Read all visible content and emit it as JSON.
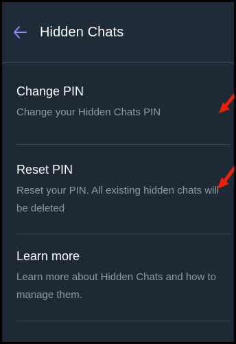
{
  "header": {
    "title": "Hidden Chats",
    "back_icon": "arrow-left-icon"
  },
  "items": [
    {
      "title": "Change PIN",
      "subtitle": "Change your Hidden Chats PIN"
    },
    {
      "title": "Reset PIN",
      "subtitle": "Reset your PIN. All existing hidden chats will be deleted"
    },
    {
      "title": "Learn more",
      "subtitle": "Learn more about Hidden Chats and how to manage them."
    }
  ],
  "annotation": {
    "color": "#e8200c"
  },
  "colors": {
    "accent": "#8b8cf0",
    "background": "#1e2936"
  }
}
